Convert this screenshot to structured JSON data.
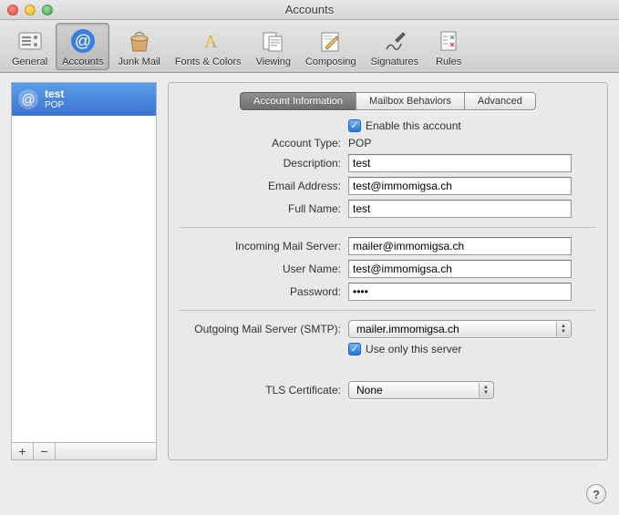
{
  "window": {
    "title": "Accounts"
  },
  "toolbar": {
    "items": [
      {
        "label": "General"
      },
      {
        "label": "Accounts"
      },
      {
        "label": "Junk Mail"
      },
      {
        "label": "Fonts & Colors"
      },
      {
        "label": "Viewing"
      },
      {
        "label": "Composing"
      },
      {
        "label": "Signatures"
      },
      {
        "label": "Rules"
      }
    ]
  },
  "sidebar": {
    "accounts": [
      {
        "name": "test",
        "type": "POP"
      }
    ],
    "add": "+",
    "remove": "−"
  },
  "tabs": {
    "info": "Account Information",
    "mailbox": "Mailbox Behaviors",
    "advanced": "Advanced"
  },
  "form": {
    "enable_label": "Enable this account",
    "account_type_label": "Account Type:",
    "account_type_value": "POP",
    "description_label": "Description:",
    "description_value": "test",
    "email_label": "Email Address:",
    "email_value": "test@immomigsa.ch",
    "fullname_label": "Full Name:",
    "fullname_value": "test",
    "incoming_label": "Incoming Mail Server:",
    "incoming_value": "mailer@immomigsa.ch",
    "username_label": "User Name:",
    "username_value": "test@immomigsa.ch",
    "password_label": "Password:",
    "password_value": "••••",
    "smtp_label": "Outgoing Mail Server (SMTP):",
    "smtp_value": "mailer.immomigsa.ch",
    "useonly_label": "Use only this server",
    "tls_label": "TLS Certificate:",
    "tls_value": "None"
  },
  "help": "?"
}
